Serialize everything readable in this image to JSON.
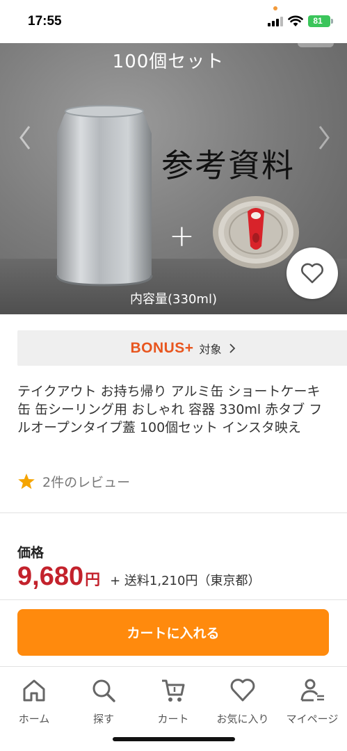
{
  "status_bar": {
    "time": "17:55",
    "battery": "81"
  },
  "hero": {
    "caption_top": "100個セット",
    "reference_text": "参考資料",
    "plus_text": "+",
    "caption_bottom": "内容量(330ml)"
  },
  "bonus": {
    "logo": "BONUS+",
    "label": "対象"
  },
  "product": {
    "title": "テイクアウト お持ち帰り アルミ缶 ショートケーキ缶 缶シーリング用 おしゃれ 容器 330ml 赤タブ フルオープンタイプ蓋 100個セット インスタ映え",
    "reviews": "2件のレビュー"
  },
  "price": {
    "label": "価格",
    "value": "9,680",
    "unit": "円",
    "shipping": "+ 送料1,210円（東京都）"
  },
  "cart_button": {
    "label": "カートに入れる"
  },
  "tabbar": {
    "items": [
      {
        "label": "ホーム",
        "icon": "home-icon"
      },
      {
        "label": "探す",
        "icon": "search-icon"
      },
      {
        "label": "カート",
        "icon": "cart-icon"
      },
      {
        "label": "お気に入り",
        "icon": "heart-icon"
      },
      {
        "label": "マイページ",
        "icon": "user-icon"
      }
    ]
  },
  "colors": {
    "accent": "#ff8a0d",
    "price": "#c3222c",
    "bonus": "#e8561f",
    "star": "#f5a400",
    "battery": "#3bc55b"
  }
}
